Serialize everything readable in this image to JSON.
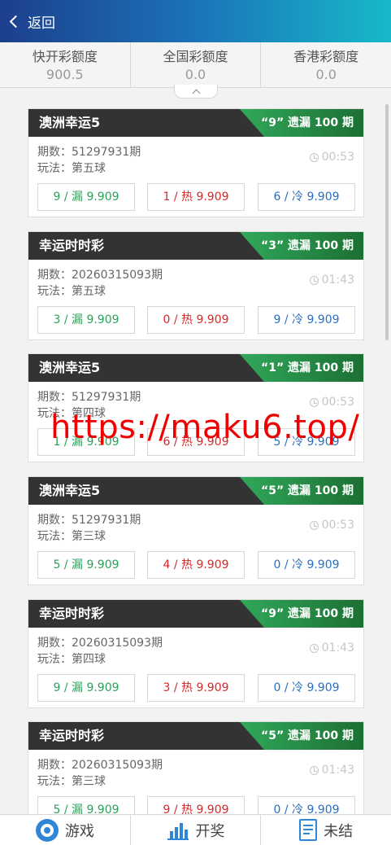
{
  "header": {
    "back_label": "返回"
  },
  "balances": [
    {
      "label": "快开彩额度",
      "value": "900.5"
    },
    {
      "label": "全国彩额度",
      "value": "0.0"
    },
    {
      "label": "香港彩额度",
      "value": "0.0"
    }
  ],
  "cards": [
    {
      "title": "澳洲幸运5",
      "badge": "“9” 遗漏 100 期",
      "issue": "期数：51297931期",
      "play": "玩法：第五球",
      "timer": "00:53",
      "miss": "9 / 漏 9.909",
      "hot": "1 / 热 9.909",
      "cold": "6 / 冷 9.909"
    },
    {
      "title": "幸运时时彩",
      "badge": "“3” 遗漏 100 期",
      "issue": "期数：20260315093期",
      "play": "玩法：第五球",
      "timer": "01:43",
      "miss": "3 / 漏 9.909",
      "hot": "0 / 热 9.909",
      "cold": "9 / 冷 9.909"
    },
    {
      "title": "澳洲幸运5",
      "badge": "“1” 遗漏 100 期",
      "issue": "期数：51297931期",
      "play": "玩法：第四球",
      "timer": "00:53",
      "miss": "1 / 漏 9.909",
      "hot": "6 / 热 9.909",
      "cold": "5 / 冷 9.909"
    },
    {
      "title": "澳洲幸运5",
      "badge": "“5” 遗漏 100 期",
      "issue": "期数：51297931期",
      "play": "玩法：第三球",
      "timer": "00:53",
      "miss": "5 / 漏 9.909",
      "hot": "4 / 热 9.909",
      "cold": "0 / 冷 9.909"
    },
    {
      "title": "幸运时时彩",
      "badge": "“9” 遗漏 100 期",
      "issue": "期数：20260315093期",
      "play": "玩法：第四球",
      "timer": "01:43",
      "miss": "9 / 漏 9.909",
      "hot": "3 / 热 9.909",
      "cold": "0 / 冷 9.909"
    },
    {
      "title": "幸运时时彩",
      "badge": "“5” 遗漏 100 期",
      "issue": "期数：20260315093期",
      "play": "玩法：第三球",
      "timer": "01:43",
      "miss": "5 / 漏 9.909",
      "hot": "9 / 热 9.909",
      "cold": "0 / 冷 9.909"
    }
  ],
  "watermark": "https://maku6.top/",
  "tabs": [
    {
      "label": "游戏",
      "icon": "game-icon"
    },
    {
      "label": "开奖",
      "icon": "bar-chart-icon"
    },
    {
      "label": "未结",
      "icon": "document-icon"
    }
  ],
  "colors": {
    "miss": "#2aa25a",
    "hot": "#d22b2b",
    "cold": "#2a6fc1",
    "badge": "#2e9e50",
    "header_start": "#1c3f8c",
    "header_end": "#16b9c9"
  }
}
